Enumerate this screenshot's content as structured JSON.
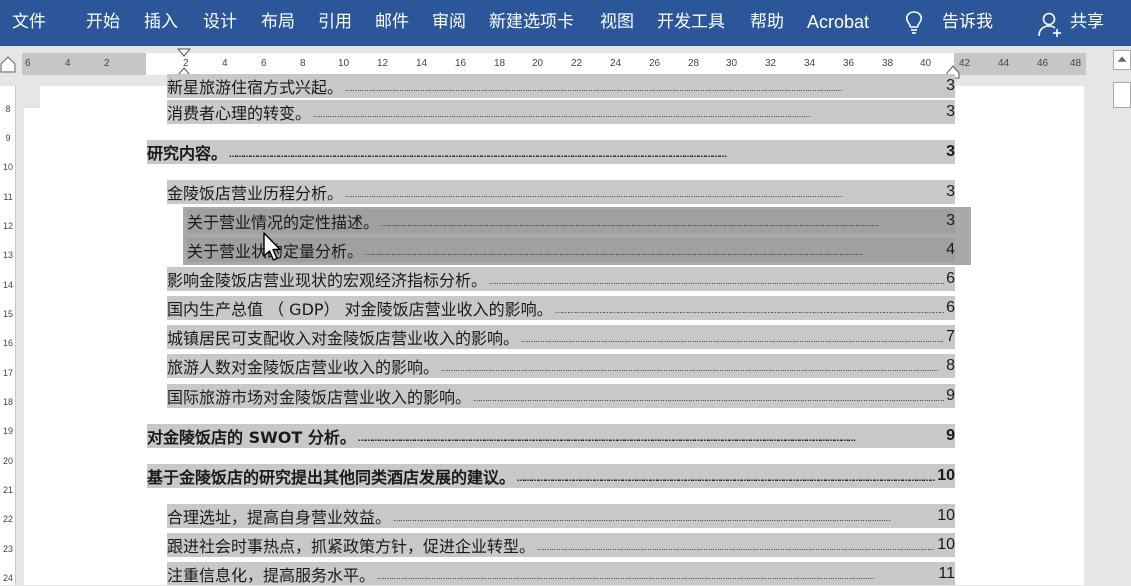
{
  "ribbon": {
    "tabs": [
      "文件",
      "开始",
      "插入",
      "设计",
      "布局",
      "引用",
      "邮件",
      "审阅",
      "新建选项卡",
      "视图",
      "开发工具",
      "帮助",
      "Acrobat"
    ],
    "tell_me": "告诉我",
    "share": "共享"
  },
  "ruler": {
    "left_numbers": [
      "6",
      "4",
      "2"
    ],
    "numbers": [
      "2",
      "4",
      "6",
      "8",
      "10",
      "12",
      "14",
      "16",
      "18",
      "20",
      "22",
      "24",
      "26",
      "28",
      "30",
      "32",
      "34",
      "36",
      "38",
      "40"
    ],
    "right_numbers": [
      "42",
      "44",
      "46",
      "48"
    ]
  },
  "vruler": [
    "8",
    "9",
    "10",
    "11",
    "12",
    "13",
    "14",
    "15",
    "16",
    "17",
    "18",
    "19",
    "20",
    "21",
    "22",
    "23",
    "24"
  ],
  "toc": [
    {
      "text": "新星旅游住宿方式兴起。",
      "page": "3",
      "level": 2
    },
    {
      "text": "消费者心理的转变。",
      "page": "3",
      "level": 2
    },
    {
      "text": "研究内容。",
      "page": "3",
      "level": 1
    },
    {
      "text": "金陵饭店营业历程分析。",
      "page": "3",
      "level": 2
    },
    {
      "text": "关于营业情况的定性描述。",
      "page": "3",
      "level": 3
    },
    {
      "text": "关于营业状的定量分析。",
      "page": "4",
      "level": 3
    },
    {
      "text": "影响金陵饭店营业现状的宏观经济指标分析。",
      "page": "6",
      "level": 2
    },
    {
      "text": "国内生产总值 （ GDP） 对金陵饭店营业收入的影响。",
      "page": "6",
      "level": 2
    },
    {
      "text": "城镇居民可支配收入对金陵饭店营业收入的影响。",
      "page": "7",
      "level": 2
    },
    {
      "text": "旅游人数对金陵饭店营业收入的影响。",
      "page": "8",
      "level": 2
    },
    {
      "text": "国际旅游市场对金陵饭店营业收入的影响。",
      "page": "9",
      "level": 2
    },
    {
      "text": "对金陵饭店的 SWOT 分析。",
      "page": "9",
      "level": 1
    },
    {
      "text": "基于金陵饭店的研究提出其他同类酒店发展的建议。",
      "page": "10",
      "level": 1
    },
    {
      "text": "合理选址，提高自身营业效益。",
      "page": "10",
      "level": 2
    },
    {
      "text": "跟进社会时事热点，抓紧政策方针，促进企业转型。",
      "page": "10",
      "level": 2
    },
    {
      "text": "注重信息化，提高服务水平。",
      "page": "11",
      "level": 2
    }
  ]
}
